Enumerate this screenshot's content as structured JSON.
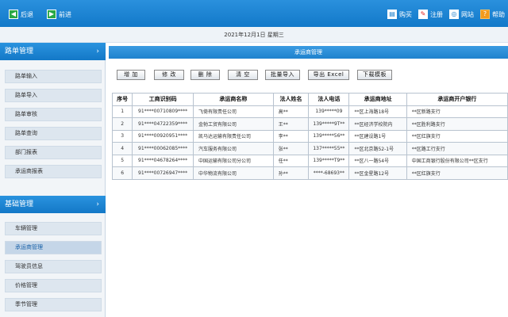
{
  "topbar": {
    "back_label": "后退",
    "forward_label": "前进",
    "buy_label": "购买",
    "register_label": "注册",
    "website_label": "网站",
    "help_label": "帮助"
  },
  "date_text": "2021年12月1日  星期三",
  "sidebar": {
    "section1": {
      "title": "路单管理",
      "items": [
        "路单输入",
        "路单导入",
        "路单审核",
        "路单查询",
        "部门报表",
        "承运商报表"
      ]
    },
    "section2": {
      "title": "基础管理",
      "items": [
        "车辆管理",
        "承运商管理",
        "驾驶员信息",
        "价格管理",
        "季节管理"
      ],
      "active_index": 1
    }
  },
  "main": {
    "title": "承运商管理",
    "buttons": [
      "增 加",
      "修 改",
      "删 除",
      "清 空",
      "批量导入",
      "导出 Excel",
      "下载模板"
    ],
    "table": {
      "headers": [
        "序号",
        "工商识别码",
        "承运商名称",
        "法人姓名",
        "法人电话",
        "承运商地址",
        "承运商开户银行"
      ],
      "rows": [
        [
          "1",
          "91****00710809****",
          "飞倚有限责任公司",
          "高**",
          "139*****09",
          "**区上海路18号",
          "**区新路支行"
        ],
        [
          "2",
          "91****04722359****",
          "金勃工贸有限公司",
          "王**",
          "139*****9T**",
          "**区经济学校院内",
          "**区胜利路支行"
        ],
        [
          "3",
          "91****00920951****",
          "凯马达运输有限责任公司",
          "李**",
          "139*****56**",
          "**区建设路1号",
          "**区红旗支行"
        ],
        [
          "4",
          "91****00062085****",
          "汽车服务有限公司",
          "张**",
          "137*****55**",
          "**区北京路52-1号",
          "**区路工行支行"
        ],
        [
          "5",
          "91****04678264****",
          "中国运输有限公司分公司",
          "任**",
          "139*****T9**",
          "**区八一路54号",
          "中国工商银行股份有限公司**区支行"
        ],
        [
          "6",
          "91****00726947****",
          "中华物流有限公司",
          "孙**",
          "****-68693**",
          "**区金星路12号",
          "**区红旗支行"
        ]
      ]
    }
  }
}
